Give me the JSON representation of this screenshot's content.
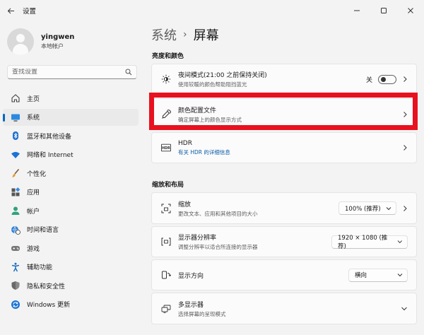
{
  "window": {
    "title": "设置"
  },
  "profile": {
    "name": "yingwen",
    "account_type": "本地帐户"
  },
  "search": {
    "placeholder": "查找设置"
  },
  "nav": {
    "items": [
      {
        "label": "主页",
        "icon": "home-icon"
      },
      {
        "label": "系统",
        "icon": "system-icon",
        "active": true
      },
      {
        "label": "蓝牙和其他设备",
        "icon": "bluetooth-icon"
      },
      {
        "label": "网络和 Internet",
        "icon": "wifi-icon"
      },
      {
        "label": "个性化",
        "icon": "brush-icon"
      },
      {
        "label": "应用",
        "icon": "apps-icon"
      },
      {
        "label": "帐户",
        "icon": "account-icon"
      },
      {
        "label": "时间和语言",
        "icon": "globe-clock-icon"
      },
      {
        "label": "游戏",
        "icon": "gamepad-icon"
      },
      {
        "label": "辅助功能",
        "icon": "accessibility-icon"
      },
      {
        "label": "隐私和安全性",
        "icon": "shield-icon"
      },
      {
        "label": "Windows 更新",
        "icon": "update-icon"
      }
    ]
  },
  "breadcrumb": {
    "parent": "系统",
    "current": "屏幕"
  },
  "sections": {
    "brightness": "亮度和颜色",
    "scale_layout": "缩放和布局"
  },
  "cards": {
    "night_light": {
      "title": "夜间模式(21:00 之前保持关闭)",
      "subtitle": "使用较暖的颜色帮助阻挡蓝光",
      "toggle_label": "关",
      "toggle_on": false
    },
    "color_profile": {
      "title": "颜色配置文件",
      "subtitle": "确定屏幕上的颜色显示方式"
    },
    "hdr": {
      "title": "HDR",
      "link": "有关 HDR 的详细信息"
    },
    "scale": {
      "title": "缩放",
      "subtitle": "更改文本、应用和其他项目的大小",
      "value": "100% (推荐)"
    },
    "resolution": {
      "title": "显示器分辨率",
      "subtitle": "调整分辨率以适合所连接的显示器",
      "value": "1920 × 1080 (推荐)"
    },
    "orientation": {
      "title": "显示方向",
      "value": "横向"
    },
    "multiple_displays": {
      "title": "多显示器",
      "subtitle": "选择屏幕的呈现模式"
    }
  },
  "colors": {
    "accent": "#0067c0",
    "highlight": "#e8111f",
    "link": "#0a5aa8"
  }
}
